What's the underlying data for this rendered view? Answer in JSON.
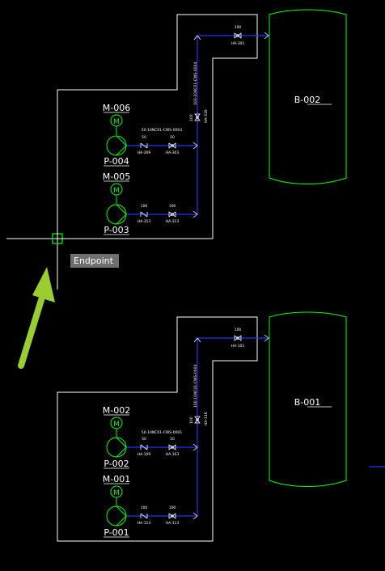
{
  "tooltip": {
    "text": "Endpoint"
  },
  "areas": [
    {
      "vessel": "B-002",
      "motors": [
        "M-006",
        "M-005"
      ],
      "pumps": [
        "P-004",
        "P-003"
      ],
      "line_tag": "50-10NC01-CWS-0003",
      "riser_tag": "100-10NC01-CWS-0004",
      "valves": {
        "upper_check": "HA-309",
        "upper_gate": "HA-303",
        "lower_check": "HA-313",
        "lower_gate": "HA-313",
        "riser": "HA-316",
        "top": "HA-301"
      },
      "sizes": {
        "upper": "50",
        "lower": "100",
        "riser": "100",
        "top": "100"
      }
    },
    {
      "vessel": "B-001",
      "motors": [
        "M-002",
        "M-001"
      ],
      "pumps": [
        "P-002",
        "P-001"
      ],
      "line_tag": "50-10NC01-CWS-0001",
      "riser_tag": "100-10NC01-CWS-0004",
      "valves": {
        "upper_check": "HA-109",
        "upper_gate": "HA-103",
        "lower_check": "HA-113",
        "lower_gate": "HA-113",
        "riser": "HA-116",
        "top": "HA-101"
      },
      "sizes": {
        "upper": "50",
        "lower": "100",
        "riser": "100",
        "top": "100"
      }
    }
  ],
  "colors": {
    "background": "#000000",
    "outline": "#ffffff",
    "equipment": "#00ff00",
    "pipe": "#2233ff",
    "arrow": "#9acd32",
    "tooltip_bg": "#6f6f6f"
  }
}
